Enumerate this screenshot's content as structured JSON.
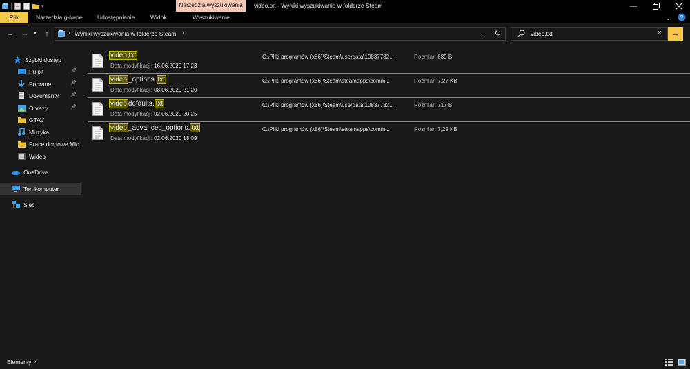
{
  "titlebar": {
    "tools_tab": "Narzędzia wyszukiwania",
    "title": "video.txt - Wyniki wyszukiwania w folderze Steam"
  },
  "ribbon": {
    "tabs": [
      "Plik",
      "Narzędzia główne",
      "Udostępnianie",
      "Widok",
      "Wyszukiwanie"
    ]
  },
  "address": {
    "path": "Wyniki wyszukiwania w folderze Steam"
  },
  "search": {
    "value": "video.txt"
  },
  "sidebar": {
    "items": [
      {
        "label": "Szybki dostęp",
        "icon": "star-icon"
      },
      {
        "label": "Pulpit",
        "icon": "desktop-icon",
        "pinned": true
      },
      {
        "label": "Pobrane",
        "icon": "download-icon",
        "pinned": true
      },
      {
        "label": "Dokumenty",
        "icon": "documents-icon",
        "pinned": true
      },
      {
        "label": "Obrazy",
        "icon": "pictures-icon",
        "pinned": true
      },
      {
        "label": "GTAV",
        "icon": "folder-icon"
      },
      {
        "label": "Muzyka",
        "icon": "music-icon"
      },
      {
        "label": "Prace domowe Mic",
        "icon": "folder-icon"
      },
      {
        "label": "Wideo",
        "icon": "video-icon"
      },
      {
        "label": "OneDrive",
        "icon": "onedrive-icon"
      },
      {
        "label": "Ten komputer",
        "icon": "computer-icon"
      },
      {
        "label": "Sieć",
        "icon": "network-icon"
      }
    ]
  },
  "results": {
    "date_label": "Data modyfikacji:",
    "size_label": "Rozmiar:",
    "rows": [
      {
        "name_parts": [
          {
            "t": "video.txt",
            "h": true
          }
        ],
        "date": "16.06.2020 17:23",
        "path": "C:\\Pliki programów (x86)\\Steam\\userdata\\10837782...",
        "size": "689 B"
      },
      {
        "name_parts": [
          {
            "t": "video",
            "h": true
          },
          {
            "t": "_options.",
            "h": false
          },
          {
            "t": "txt",
            "h": true
          }
        ],
        "date": "08.06.2020 21:20",
        "path": "C:\\Pliki programów (x86)\\Steam\\steamapps\\comm...",
        "size": "7,27 KB"
      },
      {
        "name_parts": [
          {
            "t": "video",
            "h": true
          },
          {
            "t": "defaults.",
            "h": false
          },
          {
            "t": "txt",
            "h": true
          }
        ],
        "date": "02.06.2020 20:25",
        "path": "C:\\Pliki programów (x86)\\Steam\\userdata\\10837782...",
        "size": "717 B"
      },
      {
        "name_parts": [
          {
            "t": "video",
            "h": true
          },
          {
            "t": "_advanced_options.",
            "h": false
          },
          {
            "t": "txt",
            "h": true
          }
        ],
        "date": "02.06.2020 18:09",
        "path": "C:\\Pliki programów (x86)\\Steam\\steamapps\\comm...",
        "size": "7,29 KB"
      }
    ]
  },
  "status": {
    "count": "Elementy: 4"
  },
  "colors": {
    "accent": "#f5c74a",
    "tools_tab": "#f5c7b5",
    "highlight_bg": "#5b5a00",
    "highlight_border": "#c9c000"
  }
}
